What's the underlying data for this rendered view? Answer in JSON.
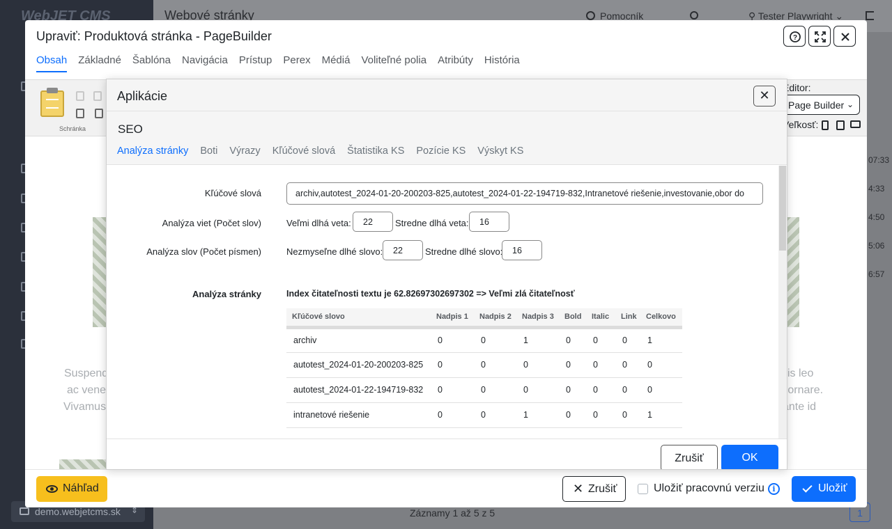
{
  "background": {
    "logo": "WebJET CMS",
    "page_title": "Webové stránky",
    "help": "Pomocník",
    "user": "Tester Playwright",
    "domain": "demo.webjetcms.sk",
    "records": "Záznamy 1 až 5 z 5",
    "page_number": "1",
    "times": [
      "07:33",
      "4:33",
      "4:50",
      "5:06",
      "6:57"
    ]
  },
  "modal": {
    "title": "Upraviť: Produktová stránka - PageBuilder",
    "tabs": [
      "Obsah",
      "Základné",
      "Šablóna",
      "Navigácia",
      "Prístup",
      "Perex",
      "Médiá",
      "Voliteľné polia",
      "Atribúty",
      "História"
    ],
    "active_tab": "Obsah",
    "toolbar": {
      "clipboard_label": "Schránka",
      "editor_label": "Editor:",
      "editor_value": "Page Builder",
      "size_label": "Veľkosť:"
    },
    "lorem": {
      "left": [
        "Suspend",
        "ac vene",
        "Vivamus"
      ],
      "right": [
        "is leo",
        "n ornare.",
        "ante id"
      ]
    },
    "footer": {
      "preview": "Náhľad",
      "cancel": "Zrušiť",
      "save_draft": "Uložiť pracovnú verziu",
      "save": "Uložiť"
    }
  },
  "dialog": {
    "title": "Aplikácie",
    "section": "SEO",
    "tabs": [
      "Analýza stránky",
      "Boti",
      "Výrazy",
      "Kľúčové slová",
      "Štatistika KS",
      "Pozície KS",
      "Výskyt KS"
    ],
    "active_tab": "Analýza stránky",
    "form": {
      "keywords_label": "Kľúčové slová",
      "keywords_value": "archiv,autotest_2024-01-20-200203-825,autotest_2024-01-22-194719-832,Intranetové riešenie,investovanie,obor do",
      "sentence_label": "Analýza viet (Počet slov)",
      "very_long_sentence_label": "Veľmi dlhá veta:",
      "very_long_sentence_value": "22",
      "medium_long_sentence_label": "Stredne dlhá veta:",
      "medium_long_sentence_value": "16",
      "word_label": "Analýza slov (Počet písmen)",
      "nonsense_word_label": "Nezmyseľne dlhé slovo:",
      "nonsense_word_value": "22",
      "medium_word_label": "Stredne dlhé slovo:",
      "medium_word_value": "16",
      "analysis_label": "Analýza stránky",
      "readability": "Index čitateľnosti textu je 62.82697302697302 => Veľmi zlá čitateľnosť"
    },
    "table": {
      "columns": [
        "Kľúčové slovo",
        "Nadpis 1",
        "Nadpis 2",
        "Nadpis 3",
        "Bold",
        "Italic",
        "Link",
        "Celkovo"
      ],
      "rows": [
        [
          "archiv",
          "0",
          "0",
          "1",
          "0",
          "0",
          "0",
          "1"
        ],
        [
          "autotest_2024-01-20-200203-825",
          "0",
          "0",
          "0",
          "0",
          "0",
          "0",
          "0"
        ],
        [
          "autotest_2024-01-22-194719-832",
          "0",
          "0",
          "0",
          "0",
          "0",
          "0",
          "0"
        ],
        [
          "intranetové riešenie",
          "0",
          "0",
          "1",
          "0",
          "0",
          "0",
          "1"
        ]
      ]
    },
    "footer": {
      "cancel": "Zrušiť",
      "ok": "OK"
    }
  }
}
